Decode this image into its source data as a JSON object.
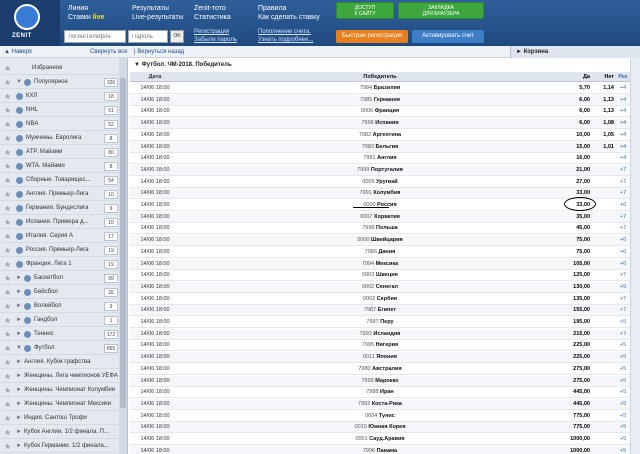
{
  "header": {
    "logo_text": "ZENIT",
    "nav": [
      {
        "line1": "Линия",
        "line2": "Ставки",
        "live": "live"
      },
      {
        "line1": "Результаты",
        "line2": "Live-результаты"
      },
      {
        "line1": "Zenit-тото",
        "line2": "Статистика"
      },
      {
        "line1": "Правила",
        "line2": "Как сделать ставку"
      }
    ],
    "access_button": "ДОСТУП\nК САЙТУ",
    "bookmark_button": "ЗАКЛАДКА\nДЛЯ БРАУЗЕРА",
    "login_placeholder": "Логин/Телефон",
    "password_placeholder": "Пароль",
    "ok_label": "OK",
    "register_link": "Регистрация",
    "forgot_link": "Забыли пароль",
    "deposit_link": "Пополнение счета.",
    "learn_more_link": "Узнать подробнее...",
    "quick_register_button": "Быстрая регистрация",
    "activate_button": "Активировать счет"
  },
  "subbar": {
    "back_up": "▲ Наверх",
    "collapse_all": "Свернуть все",
    "back": "| Вернуться назад",
    "basket": "► Корзина"
  },
  "sidebar": {
    "items": [
      {
        "label": "Избранное",
        "count": "",
        "arrow": "",
        "icon": "star-icon"
      },
      {
        "label": "Популярное",
        "count": "326",
        "arrow": "▼",
        "icon": "star-icon"
      },
      {
        "label": "КХЛ",
        "count": "18",
        "arrow": "",
        "icon": "hockey-icon"
      },
      {
        "label": "NHL",
        "count": "61",
        "arrow": "",
        "icon": "hockey-icon"
      },
      {
        "label": "NBA",
        "count": "52",
        "arrow": "",
        "icon": "basketball-icon"
      },
      {
        "label": "Мужчины. Евролига",
        "count": "8",
        "arrow": "",
        "icon": "basketball-icon"
      },
      {
        "label": "ATP. Майами",
        "count": "80",
        "arrow": "",
        "icon": "tennis-icon"
      },
      {
        "label": "WTA. Майами",
        "count": "8",
        "arrow": "",
        "icon": "tennis-icon"
      },
      {
        "label": "Сборные. Товарищес...",
        "count": "54",
        "arrow": "",
        "icon": "football-icon"
      },
      {
        "label": "Англия. Премьер-Лига",
        "count": "10",
        "arrow": "",
        "icon": "football-icon"
      },
      {
        "label": "Германия. Бундеслига",
        "count": "9",
        "arrow": "",
        "icon": "football-icon"
      },
      {
        "label": "Испания. Примера д...",
        "count": "10",
        "arrow": "",
        "icon": "football-icon"
      },
      {
        "label": "Италия. Серия А",
        "count": "17",
        "arrow": "",
        "icon": "football-icon"
      },
      {
        "label": "Россия. Премьер-Лига",
        "count": "19",
        "arrow": "",
        "icon": "football-icon"
      },
      {
        "label": "Франция. Лига 1",
        "count": "19",
        "arrow": "",
        "icon": "football-icon"
      },
      {
        "label": "Баскетбол",
        "count": "99",
        "arrow": "►",
        "icon": "basketball-icon"
      },
      {
        "label": "Бейсбол",
        "count": "26",
        "arrow": "►",
        "icon": "baseball-icon"
      },
      {
        "label": "Волейбол",
        "count": "9",
        "arrow": "►",
        "icon": "volleyball-icon"
      },
      {
        "label": "Гандбол",
        "count": "1",
        "arrow": "►",
        "icon": "handball-icon"
      },
      {
        "label": "Теннис",
        "count": "172",
        "arrow": "►",
        "icon": "tennis-icon"
      },
      {
        "label": "Футбол",
        "count": "865",
        "arrow": "▼",
        "icon": "football-icon"
      },
      {
        "label": "Англия. Кубок графства",
        "count": "",
        "arrow": "►",
        "icon": ""
      },
      {
        "label": "Женщины. Лига чемпионов УЕФА",
        "count": "",
        "arrow": "►",
        "icon": ""
      },
      {
        "label": "Женщины. Чемпионат Колумбии",
        "count": "",
        "arrow": "►",
        "icon": ""
      },
      {
        "label": "Женщины. Чемпионат Мексики",
        "count": "",
        "arrow": "►",
        "icon": ""
      },
      {
        "label": "Индия. Сантош Трофи",
        "count": "",
        "arrow": "►",
        "icon": ""
      },
      {
        "label": "Кубок Англии. 1/2 финала. П...",
        "count": "",
        "arrow": "►",
        "icon": ""
      },
      {
        "label": "Кубок Германии. 1/2 финала...",
        "count": "",
        "arrow": "►",
        "icon": ""
      }
    ]
  },
  "table": {
    "title": "Футбол. ЧМ-2018. Победитель",
    "headers": {
      "date": "Дата",
      "winner": "Победитель",
      "yes": "Да",
      "no": "Нет",
      "rec": "Рек"
    },
    "rows": [
      {
        "date": "14/06 18:00",
        "num": "7984",
        "team": "Бразилия",
        "yes": "5,70",
        "no": "1,14",
        "rec": "+4"
      },
      {
        "date": "14/06 18:00",
        "num": "7985",
        "team": "Германия",
        "yes": "6,00",
        "no": "1,13",
        "rec": "+4"
      },
      {
        "date": "14/06 18:00",
        "num": "0006",
        "team": "Франция",
        "yes": "6,00",
        "no": "1,13",
        "rec": "+4"
      },
      {
        "date": "14/06 18:00",
        "num": "7998",
        "team": "Испания",
        "yes": "6,00",
        "no": "1,08",
        "rec": "+4"
      },
      {
        "date": "14/06 18:00",
        "num": "7982",
        "team": "Аргентина",
        "yes": "10,00",
        "no": "1,05",
        "rec": "+4"
      },
      {
        "date": "14/06 18:00",
        "num": "7983",
        "team": "Бельгия",
        "yes": "15,00",
        "no": "1,01",
        "rec": "+4"
      },
      {
        "date": "14/06 18:00",
        "num": "7981",
        "team": "Англия",
        "yes": "16,00",
        "no": "",
        "rec": "+4"
      },
      {
        "date": "14/06 18:00",
        "num": "7999",
        "team": "Португалия",
        "yes": "21,00",
        "no": "",
        "rec": "+7"
      },
      {
        "date": "14/06 18:00",
        "num": "0005",
        "team": "Уругвай",
        "yes": "27,00",
        "no": "",
        "rec": "+7"
      },
      {
        "date": "14/06 18:00",
        "num": "7991",
        "team": "Колумбия",
        "yes": "33,00",
        "no": "",
        "rec": "+7"
      },
      {
        "date": "14/06 18:00",
        "num": "0000",
        "team": "Россия",
        "yes": "33,00",
        "no": "",
        "rec": "+6"
      },
      {
        "date": "14/06 18:00",
        "num": "0007",
        "team": "Хорватия",
        "yes": "35,00",
        "no": "",
        "rec": "+7"
      },
      {
        "date": "14/06 18:00",
        "num": "7998",
        "team": "Польша",
        "yes": "45,00",
        "no": "",
        "rec": "+7"
      },
      {
        "date": "14/06 18:00",
        "num": "0000",
        "team": "Швейцария",
        "yes": "75,00",
        "no": "",
        "rec": "+6"
      },
      {
        "date": "14/06 18:00",
        "num": "7986",
        "team": "Дания",
        "yes": "75,00",
        "no": "",
        "rec": "+6"
      },
      {
        "date": "14/06 18:00",
        "num": "7994",
        "team": "Мексика",
        "yes": "105,00",
        "no": "",
        "rec": "+6"
      },
      {
        "date": "14/06 18:00",
        "num": "0003",
        "team": "Швеция",
        "yes": "125,00",
        "no": "",
        "rec": "+7"
      },
      {
        "date": "14/06 18:00",
        "num": "0002",
        "team": "Сенегал",
        "yes": "130,00",
        "no": "",
        "rec": "+5"
      },
      {
        "date": "14/06 18:00",
        "num": "0002",
        "team": "Сербия",
        "yes": "135,00",
        "no": "",
        "rec": "+7"
      },
      {
        "date": "14/06 18:00",
        "num": "7987",
        "team": "Египет",
        "yes": "155,00",
        "no": "",
        "rec": "+7"
      },
      {
        "date": "14/06 18:00",
        "num": "7997",
        "team": "Перу",
        "yes": "195,00",
        "no": "",
        "rec": "+5"
      },
      {
        "date": "14/06 18:00",
        "num": "7993",
        "team": "Исландия",
        "yes": "215,00",
        "no": "",
        "rec": "+7"
      },
      {
        "date": "14/06 18:00",
        "num": "7995",
        "team": "Нигерия",
        "yes": "225,00",
        "no": "",
        "rec": "+5"
      },
      {
        "date": "14/06 18:00",
        "num": "0011",
        "team": "Япония",
        "yes": "225,00",
        "no": "",
        "rec": "+5"
      },
      {
        "date": "14/06 18:00",
        "num": "7980",
        "team": "Австралия",
        "yes": "275,00",
        "no": "",
        "rec": "+5"
      },
      {
        "date": "14/06 18:00",
        "num": "7995",
        "team": "Марокко",
        "yes": "275,00",
        "no": "",
        "rec": "+5"
      },
      {
        "date": "14/06 18:00",
        "num": "7988",
        "team": "Иран",
        "yes": "445,00",
        "no": "",
        "rec": "+5"
      },
      {
        "date": "14/06 18:00",
        "num": "7992",
        "team": "Коста-Рика",
        "yes": "445,00",
        "no": "",
        "rec": "+5"
      },
      {
        "date": "14/06 18:00",
        "num": "0004",
        "team": "Тунис",
        "yes": "775,00",
        "no": "",
        "rec": "+5"
      },
      {
        "date": "14/06 18:00",
        "num": "0010",
        "team": "Южная Корея",
        "yes": "775,00",
        "no": "",
        "rec": "+5"
      },
      {
        "date": "14/06 18:00",
        "num": "0001",
        "team": "Сауд.Аравия",
        "yes": "1000,00",
        "no": "",
        "rec": "+5"
      },
      {
        "date": "14/06 18:00",
        "num": "7996",
        "team": "Панама",
        "yes": "1000,00",
        "no": "",
        "rec": "+5"
      }
    ]
  }
}
